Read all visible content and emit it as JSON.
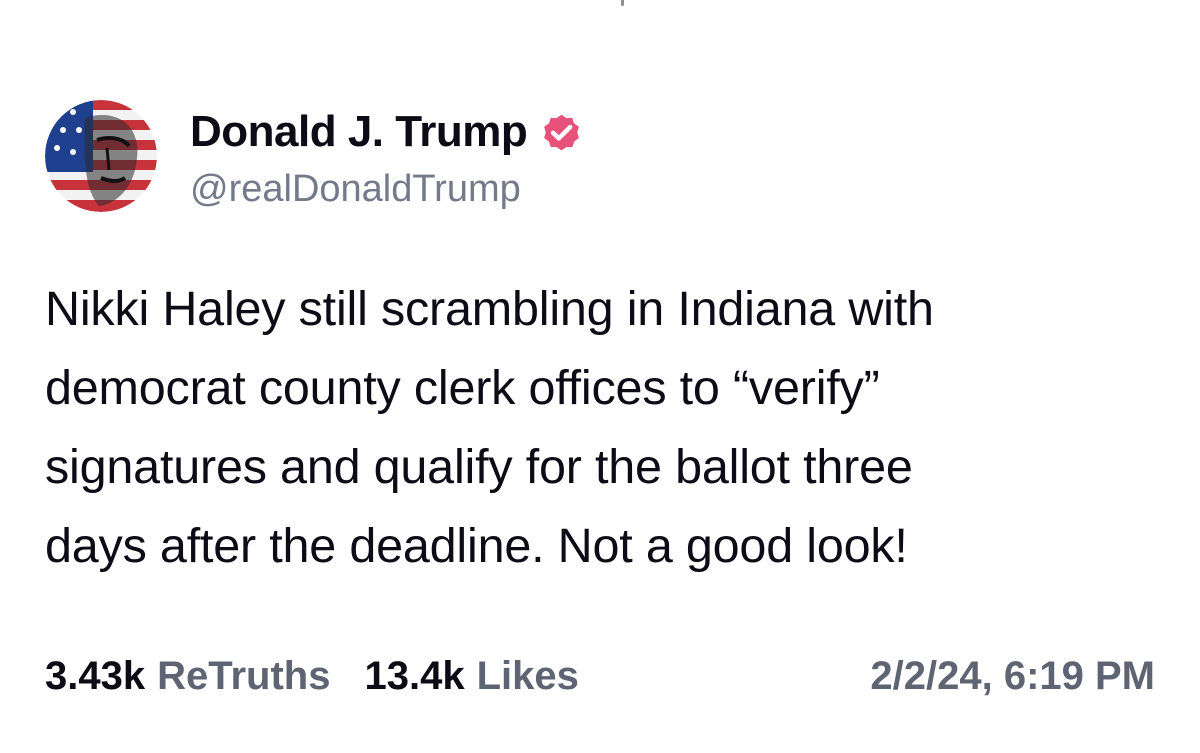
{
  "author": {
    "display_name": "Donald J. Trump",
    "handle": "@realDonaldTrump",
    "verified": true,
    "avatar_icon": "profile-portrait-flag",
    "verified_color": "#e8527a"
  },
  "post": {
    "lines": [
      "Nikki Haley still scrambling in Indiana with",
      "democrat county clerk offices to “verify”",
      "signatures and qualify for the ballot three",
      "days after the deadline. Not a good look!"
    ]
  },
  "stats": {
    "retruths_count": "3.43k",
    "retruths_label": "ReTruths",
    "likes_count": "13.4k",
    "likes_label": "Likes",
    "timestamp": "2/2/24, 6:19 PM"
  },
  "colors": {
    "text_primary": "#0d0c16",
    "text_secondary": "#757a8a",
    "stat_label": "#5f6473",
    "verified_badge": "#e8527a"
  }
}
